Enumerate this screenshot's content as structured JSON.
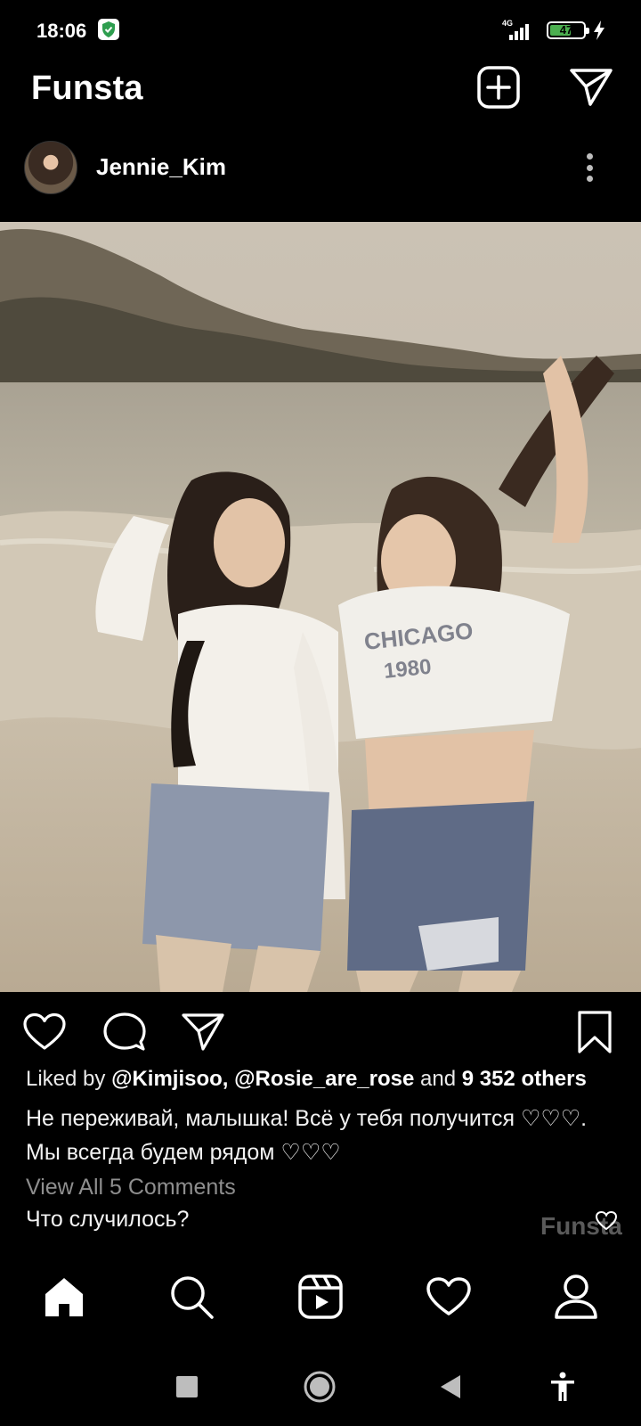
{
  "status_bar": {
    "time": "18:06",
    "network_type": "4G",
    "battery_level": "47",
    "icons": [
      "shield-check-icon",
      "signal-icon",
      "battery-icon",
      "charging-bolt-icon"
    ]
  },
  "header": {
    "title": "Funsta",
    "icons": [
      "add-post-icon",
      "direct-message-icon"
    ]
  },
  "post": {
    "username": "Jennie_Kim",
    "likes": {
      "prefix": "Liked by",
      "users": "@Kimjisoo, @Rosie_are_rose",
      "connector": "and",
      "others": "9 352 others"
    },
    "caption": "Не переживай, малышка! Всё у тебя получится ♡♡♡. Мы всегда будем рядом ♡♡♡",
    "view_comments": "View All 5 Comments",
    "comment": "Что случилось?",
    "watermark": "Funsta",
    "action_icons": [
      "heart-icon",
      "comment-icon",
      "share-icon",
      "bookmark-icon"
    ]
  },
  "bottom_nav": {
    "items": [
      "home-icon",
      "search-icon",
      "reels-icon",
      "activity-heart-icon",
      "profile-icon"
    ],
    "active": "home-icon"
  },
  "system_nav": {
    "items": [
      "recents-icon",
      "home-circle-icon",
      "back-icon",
      "accessibility-icon"
    ]
  },
  "colors": {
    "background": "#000000",
    "text": "#ffffff",
    "muted_text": "#8e8e8e",
    "battery_fill": "#4caf50"
  }
}
